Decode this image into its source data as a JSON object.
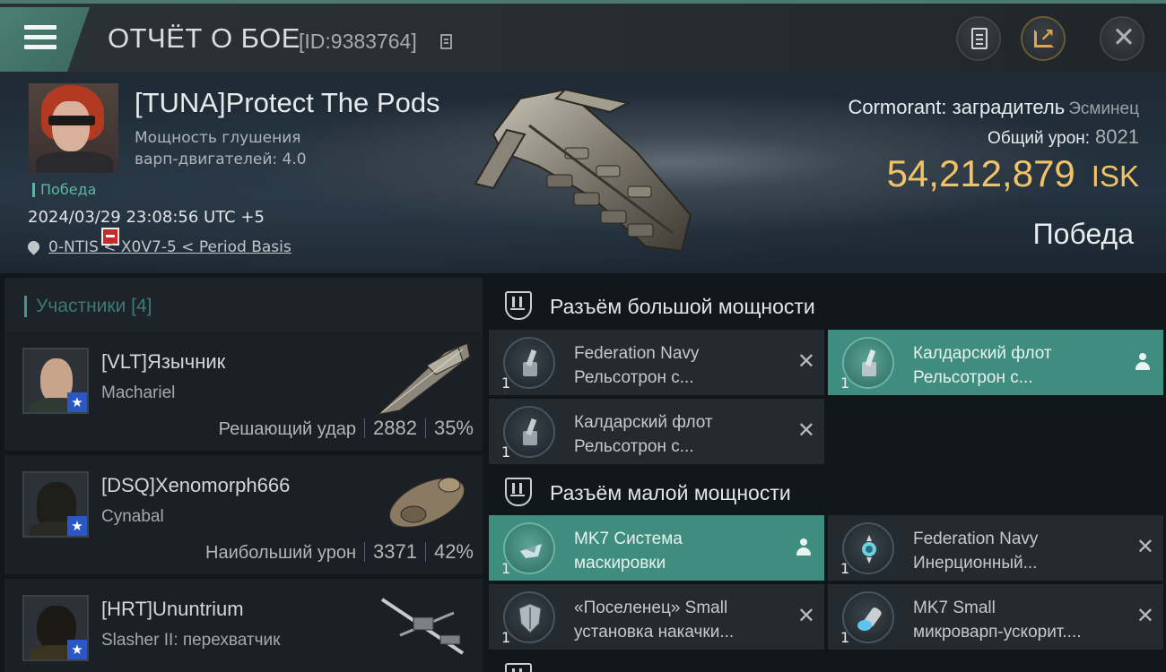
{
  "header": {
    "title": "ОТЧЁТ О БОЕ",
    "report_id": "[ID:9383764]"
  },
  "victim": {
    "name": "[TUNA]Protect The Pods",
    "stat_line1": "Мощность глушения",
    "stat_line2": "варп-двигателей: 4.0",
    "tag": "Победа",
    "datetime": "2024/03/29 23:08:56 UTC +5",
    "location": "0-NTIS < X0V7-5 < Period Basis",
    "ship_name": "Cormorant: заградитель",
    "ship_class": "Эсминец",
    "total_damage_label": "Общий урон:",
    "total_damage": "8021",
    "isk_value": "54,212,879",
    "isk_unit": "ISK",
    "result": "Победа"
  },
  "participants": {
    "header": "Участники [4]",
    "items": [
      {
        "name": "[VLT]Язычник",
        "ship": "Machariel",
        "role": "Решающий удар",
        "damage": "2882",
        "percent": "35%"
      },
      {
        "name": "[DSQ]Xenomorph666",
        "ship": "Cynabal",
        "role": "Наибольший урон",
        "damage": "3371",
        "percent": "42%"
      },
      {
        "name": "[HRT]Ununtrium",
        "ship": "Slasher II: перехватчик"
      }
    ]
  },
  "slots": {
    "high_title": "Разъём большой мощности",
    "high": [
      {
        "line1": "Federation Navy",
        "line2": "Рельсотрон с...",
        "qty": "1"
      },
      {
        "line1": "Калдарский флот",
        "line2": "Рельсотрон с...",
        "qty": "1"
      },
      {
        "line1": "Калдарский флот",
        "line2": "Рельсотрон с...",
        "qty": "1"
      }
    ],
    "low_title": "Разъём малой мощности",
    "low": [
      {
        "line1": "MK7 Система",
        "line2": "маскировки",
        "qty": "1"
      },
      {
        "line1": "Federation Navy",
        "line2": "Инерционный...",
        "qty": "1"
      },
      {
        "line1": "«Поселенец» Small",
        "line2": "установка накачки...",
        "qty": "1"
      },
      {
        "line1": "MK7 Small",
        "line2": "микроварп-ускорит....",
        "qty": "1"
      }
    ]
  },
  "colors": {
    "accent": "#3f8d7f",
    "isk": "#f2c266",
    "victory": "#5fb6a0"
  }
}
